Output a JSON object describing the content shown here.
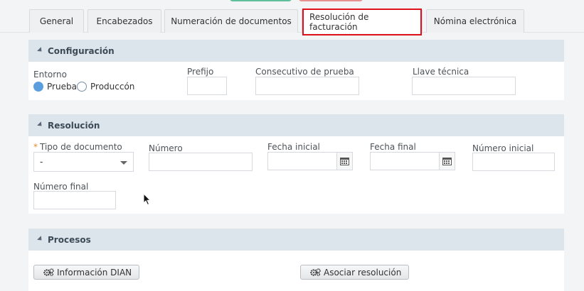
{
  "tabs": [
    {
      "label": "General",
      "active": false
    },
    {
      "label": "Encabezados",
      "active": false
    },
    {
      "label": "Numeración de documentos",
      "active": false
    },
    {
      "label": "Resolución de facturación",
      "active": true
    },
    {
      "label": "Nómina electrónica",
      "active": false
    }
  ],
  "configuracion": {
    "title": "Configuración",
    "entorno_label": "Entorno",
    "entorno_options": [
      "Prueba",
      "Produccón"
    ],
    "entorno_selected": "Prueba",
    "prefijo_label": "Prefijo",
    "prefijo_value": "",
    "consecutivo_label": "Consecutivo de prueba",
    "consecutivo_value": "",
    "llave_label": "Llave técnica",
    "llave_value": ""
  },
  "resolucion": {
    "title": "Resolución",
    "tipo_required_mark": "*",
    "tipo_label": "Tipo de documento",
    "tipo_value": "-",
    "numero_label": "Número",
    "fecha_inicial_label": "Fecha inicial",
    "fecha_final_label": "Fecha final",
    "numero_inicial_label": "Número inicial",
    "numero_final_label": "Número final"
  },
  "procesos": {
    "title": "Procesos",
    "info_dian_label": "Información DIAN",
    "asociar_label": "Asociar resolución"
  },
  "colors": {
    "accent_green": "#5fbf9a",
    "accent_red": "#e88f8f",
    "highlight_border": "#e0101a",
    "section_header_bg": "#dde5ec"
  }
}
